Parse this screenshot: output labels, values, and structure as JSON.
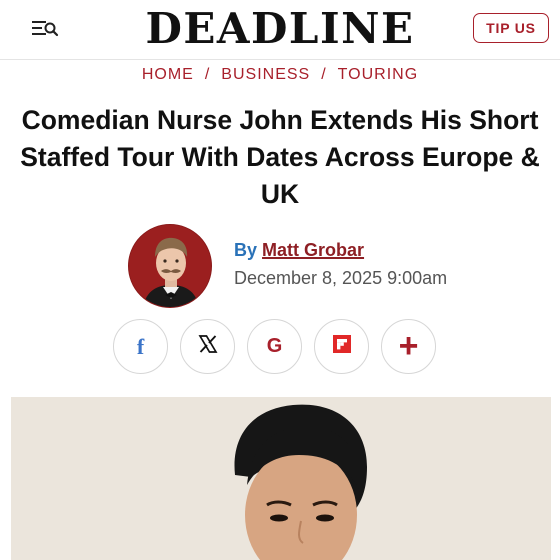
{
  "header": {
    "logo": "DEADLINE",
    "tip_label": "TIP US",
    "menu_icon": "menu-search-icon"
  },
  "breadcrumb": [
    "HOME",
    "BUSINESS",
    "TOURING"
  ],
  "article": {
    "title": "Comedian Nurse John Extends His Short Staffed Tour With Dates Across Europe & UK",
    "by_prefix": "By",
    "author": "Matt Grobar",
    "date": "December 8, 2025 9:00am"
  },
  "share": [
    {
      "icon": "facebook-icon"
    },
    {
      "icon": "x-icon"
    },
    {
      "icon": "google-icon",
      "glyph": "G"
    },
    {
      "icon": "flipboard-icon"
    },
    {
      "icon": "plus-icon"
    }
  ],
  "colors": {
    "brand_red": "#a8202b",
    "author_link": "#8e1f24",
    "by_blue": "#2a72b8",
    "facebook_blue": "#3b74c8"
  }
}
